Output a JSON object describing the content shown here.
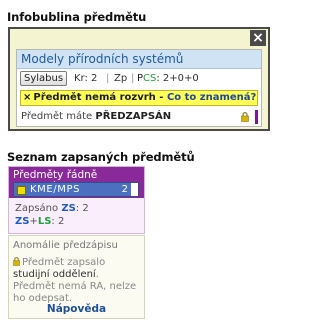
{
  "headings": {
    "tooltip": "Infobublina předmětu",
    "list": "Seznam zapsaných předmětů"
  },
  "tooltip": {
    "close_label": "×",
    "course_title": "Modely přírodních systémů",
    "syllabus_label": "Sylabus",
    "credits": "Kr: 2",
    "completion": "Zp",
    "pcs_p": "P",
    "pcs_cs": "CS",
    "pcs_value": ": 2+0+0",
    "warning_icon": "×",
    "warning_text": "Předmět nemá rozvrh",
    "warning_link": "Co to znamená?",
    "status_prefix": "Předmět máte",
    "status_value": "PŘEDZAPSÁN"
  },
  "enrolled_panel": {
    "header": "Předměty řádně zapsané",
    "course_code": "KME/MPS",
    "course_count": "2",
    "enrolled_label": "Zapsáno",
    "zs_label": "ZS",
    "zs_value": ": 2",
    "plus": "+",
    "ls_label": "LS",
    "ls_value": ": 2"
  },
  "anomaly_panel": {
    "title": "Anomálie předzápisu",
    "text_part1": "Předmět zapsalo",
    "text_dark": "studijní oddělení",
    "text_part2": ". Předmět nemá RA, nelze ho odepsat.",
    "help_link": "Nápověda"
  },
  "colors": {
    "course_header": "#cfe3f5",
    "warning_bg": "#ffff57",
    "panel_header": "#8a2a9a",
    "course_item": "#4b70c0"
  }
}
